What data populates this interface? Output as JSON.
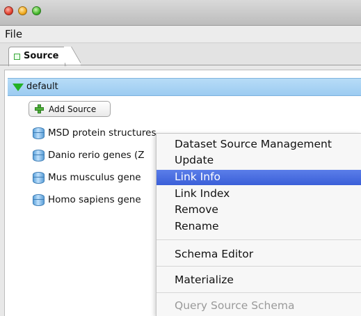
{
  "window": {
    "controls": [
      "close",
      "minimize",
      "zoom"
    ]
  },
  "menubar": {
    "file": "File"
  },
  "tabs": [
    {
      "label": "Source",
      "selected": true
    }
  ],
  "tree": {
    "group": {
      "label": "default",
      "expanded": true
    },
    "add_button": "Add Source",
    "sources": [
      {
        "label": "MSD protein structures"
      },
      {
        "label": "Danio rerio genes (Z"
      },
      {
        "label": "Mus musculus gene"
      },
      {
        "label": "Homo sapiens gene"
      }
    ]
  },
  "context_menu": {
    "items": [
      {
        "label": "Dataset Source Management",
        "state": "normal"
      },
      {
        "label": "Update",
        "state": "normal"
      },
      {
        "label": "Link Info",
        "state": "highlighted"
      },
      {
        "label": "Link Index",
        "state": "normal"
      },
      {
        "label": "Remove",
        "state": "normal"
      },
      {
        "label": "Rename",
        "state": "normal"
      },
      {
        "label": "Schema Editor",
        "state": "normal"
      },
      {
        "label": "Materialize",
        "state": "normal"
      },
      {
        "label": "Query Source Schema",
        "state": "disabled"
      }
    ]
  },
  "colors": {
    "selection_blue": "#3a5fd8",
    "group_row": "#a9d3f5",
    "expand_arrow": "#23b126"
  }
}
